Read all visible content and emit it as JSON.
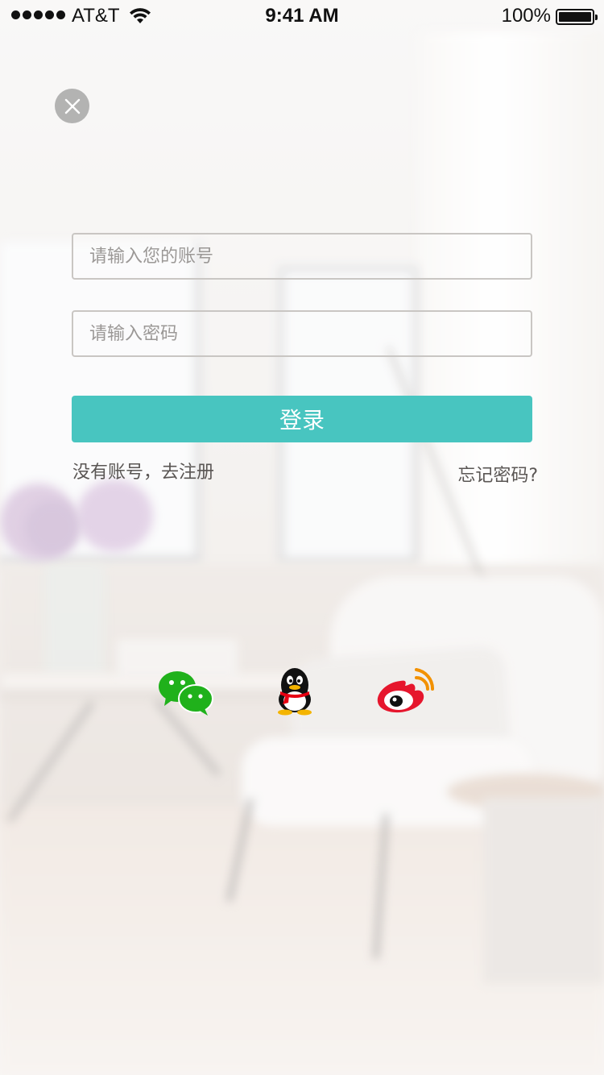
{
  "status_bar": {
    "carrier": "AT&T",
    "time": "9:41 AM",
    "battery": "100%",
    "battery_level": 1.0
  },
  "close": {
    "icon": "close-icon"
  },
  "form": {
    "account_placeholder": "请输入您的账号",
    "password_placeholder": "请输入密码",
    "login_label": "登录",
    "register_label": "没有账号，去注册",
    "forgot_label": "忘记密码?"
  },
  "social": [
    {
      "icon": "wechat-icon"
    },
    {
      "icon": "qq-icon"
    },
    {
      "icon": "weibo-icon"
    }
  ],
  "colors": {
    "accent": "#48c5c0",
    "wechat": "#20b11b",
    "weibo": "#e6162d"
  }
}
